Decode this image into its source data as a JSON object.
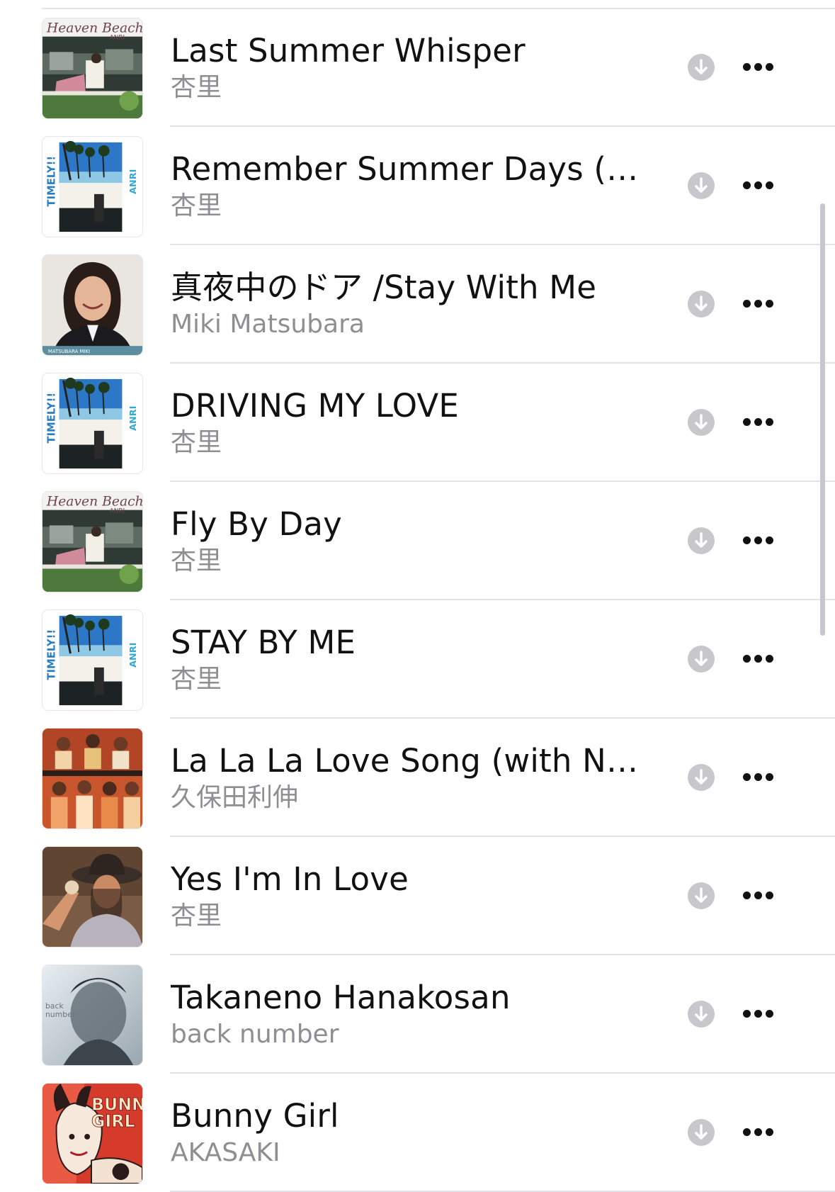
{
  "songs": [
    {
      "title": "Last Summer Whisper",
      "artist": "杏里",
      "artwork": "heaven-beach"
    },
    {
      "title": "Remember Summer Days (Bo...",
      "artist": "杏里",
      "artwork": "timely"
    },
    {
      "title": "真夜中のドア /Stay With Me",
      "artist": "Miki Matsubara",
      "artwork": "miki-portrait"
    },
    {
      "title": "DRIVING MY LOVE",
      "artist": "杏里",
      "artwork": "timely"
    },
    {
      "title": "Fly By Day",
      "artist": "杏里",
      "artwork": "heaven-beach"
    },
    {
      "title": "STAY BY ME",
      "artist": "杏里",
      "artwork": "timely"
    },
    {
      "title": "La La La Love Song (with NA...",
      "artist": "久保田利伸",
      "artwork": "kubota-group"
    },
    {
      "title": "Yes I'm In Love",
      "artist": "杏里",
      "artwork": "hat-portrait"
    },
    {
      "title": "Takaneno Hanakosan",
      "artist": "back number",
      "artwork": "back-number"
    },
    {
      "title": "Bunny Girl",
      "artist": "AKASAKI",
      "artwork": "bunny-girl"
    }
  ],
  "artwork_text": {
    "heaven_beach_script": "Heaven Beach",
    "heaven_beach_sub": "ANRI",
    "timely_left": "TIMELY!!",
    "timely_right": "ANRI",
    "miki_caption": "MATSUBARA MIKI",
    "back_number_logo": "back number",
    "bunny_line1": "BUNNY",
    "bunny_line2": "GIRL"
  },
  "icons": {
    "download": "download-arrow-circle-icon",
    "more": "ellipsis-horizontal-icon"
  },
  "colors": {
    "title": "#111111",
    "subtitle": "#8e8e93",
    "separator": "#e3e3e6",
    "download_circle": "#c7c7cc"
  }
}
